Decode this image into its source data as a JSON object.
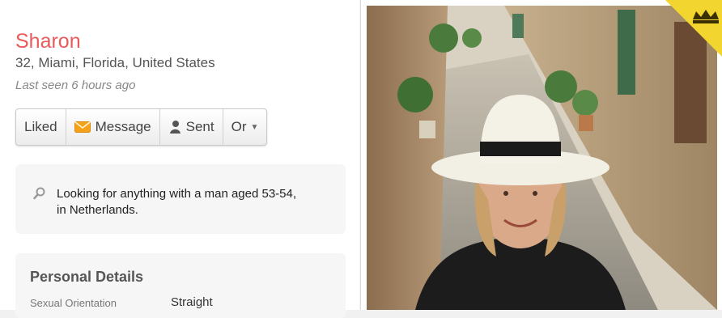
{
  "profile": {
    "name": "Sharon",
    "location": "32, Miami, Florida, United States",
    "last_seen": "Last seen 6 hours ago"
  },
  "actions": {
    "liked": "Liked",
    "message": "Message",
    "sent": "Sent",
    "or": "Or"
  },
  "looking_for": {
    "icon": "search-icon",
    "text": "Looking for anything with a man aged 53-54, in Netherlands."
  },
  "personal_details": {
    "title": "Personal Details",
    "rows": [
      {
        "label": "Sexual Orientation",
        "value": "Straight"
      }
    ]
  },
  "colors": {
    "name": "#e85b5b",
    "crown_badge": "#f2d52f"
  }
}
